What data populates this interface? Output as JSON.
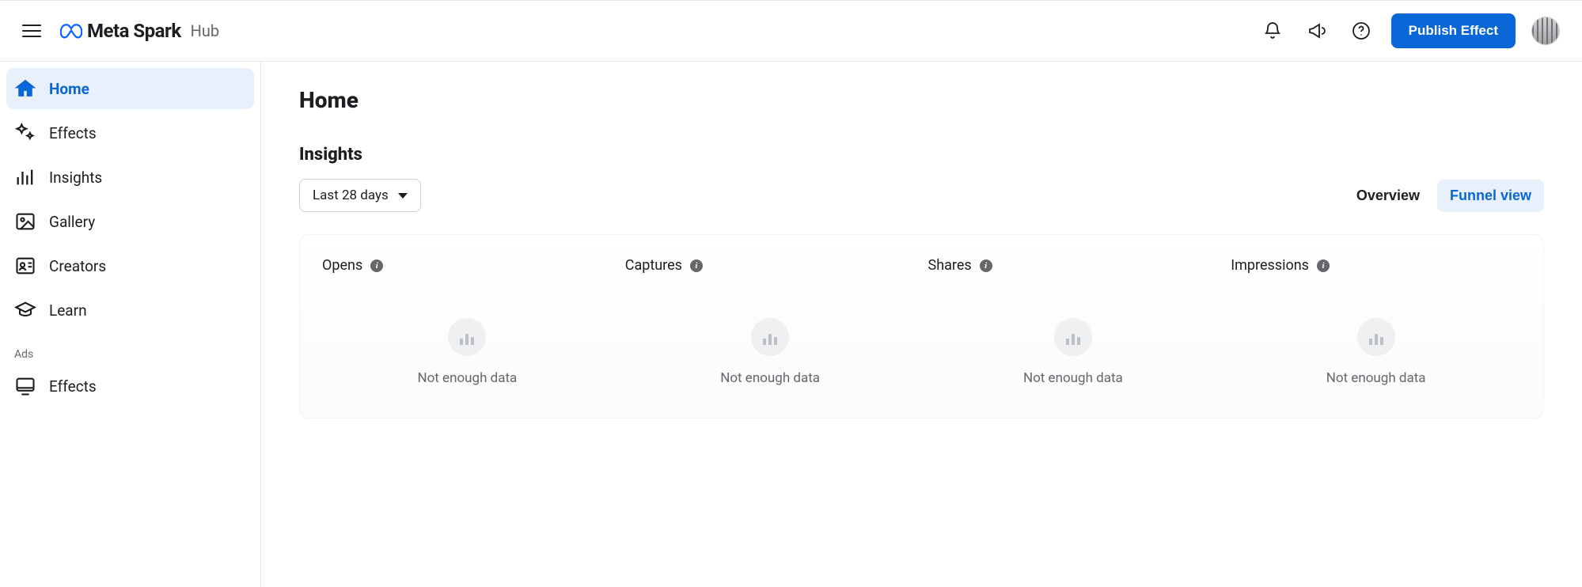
{
  "brand": {
    "name": "Meta Spark",
    "sub": "Hub"
  },
  "header": {
    "publish_label": "Publish Effect"
  },
  "sidebar": {
    "items": [
      {
        "label": "Home"
      },
      {
        "label": "Effects"
      },
      {
        "label": "Insights"
      },
      {
        "label": "Gallery"
      },
      {
        "label": "Creators"
      },
      {
        "label": "Learn"
      }
    ],
    "ads_label": "Ads",
    "ads_items": [
      {
        "label": "Effects"
      }
    ]
  },
  "page": {
    "title": "Home",
    "insights_title": "Insights",
    "range_label": "Last 28 days",
    "view_overview": "Overview",
    "view_funnel": "Funnel view",
    "metrics": [
      {
        "label": "Opens",
        "empty": "Not enough data"
      },
      {
        "label": "Captures",
        "empty": "Not enough data"
      },
      {
        "label": "Shares",
        "empty": "Not enough data"
      },
      {
        "label": "Impressions",
        "empty": "Not enough data"
      }
    ]
  }
}
